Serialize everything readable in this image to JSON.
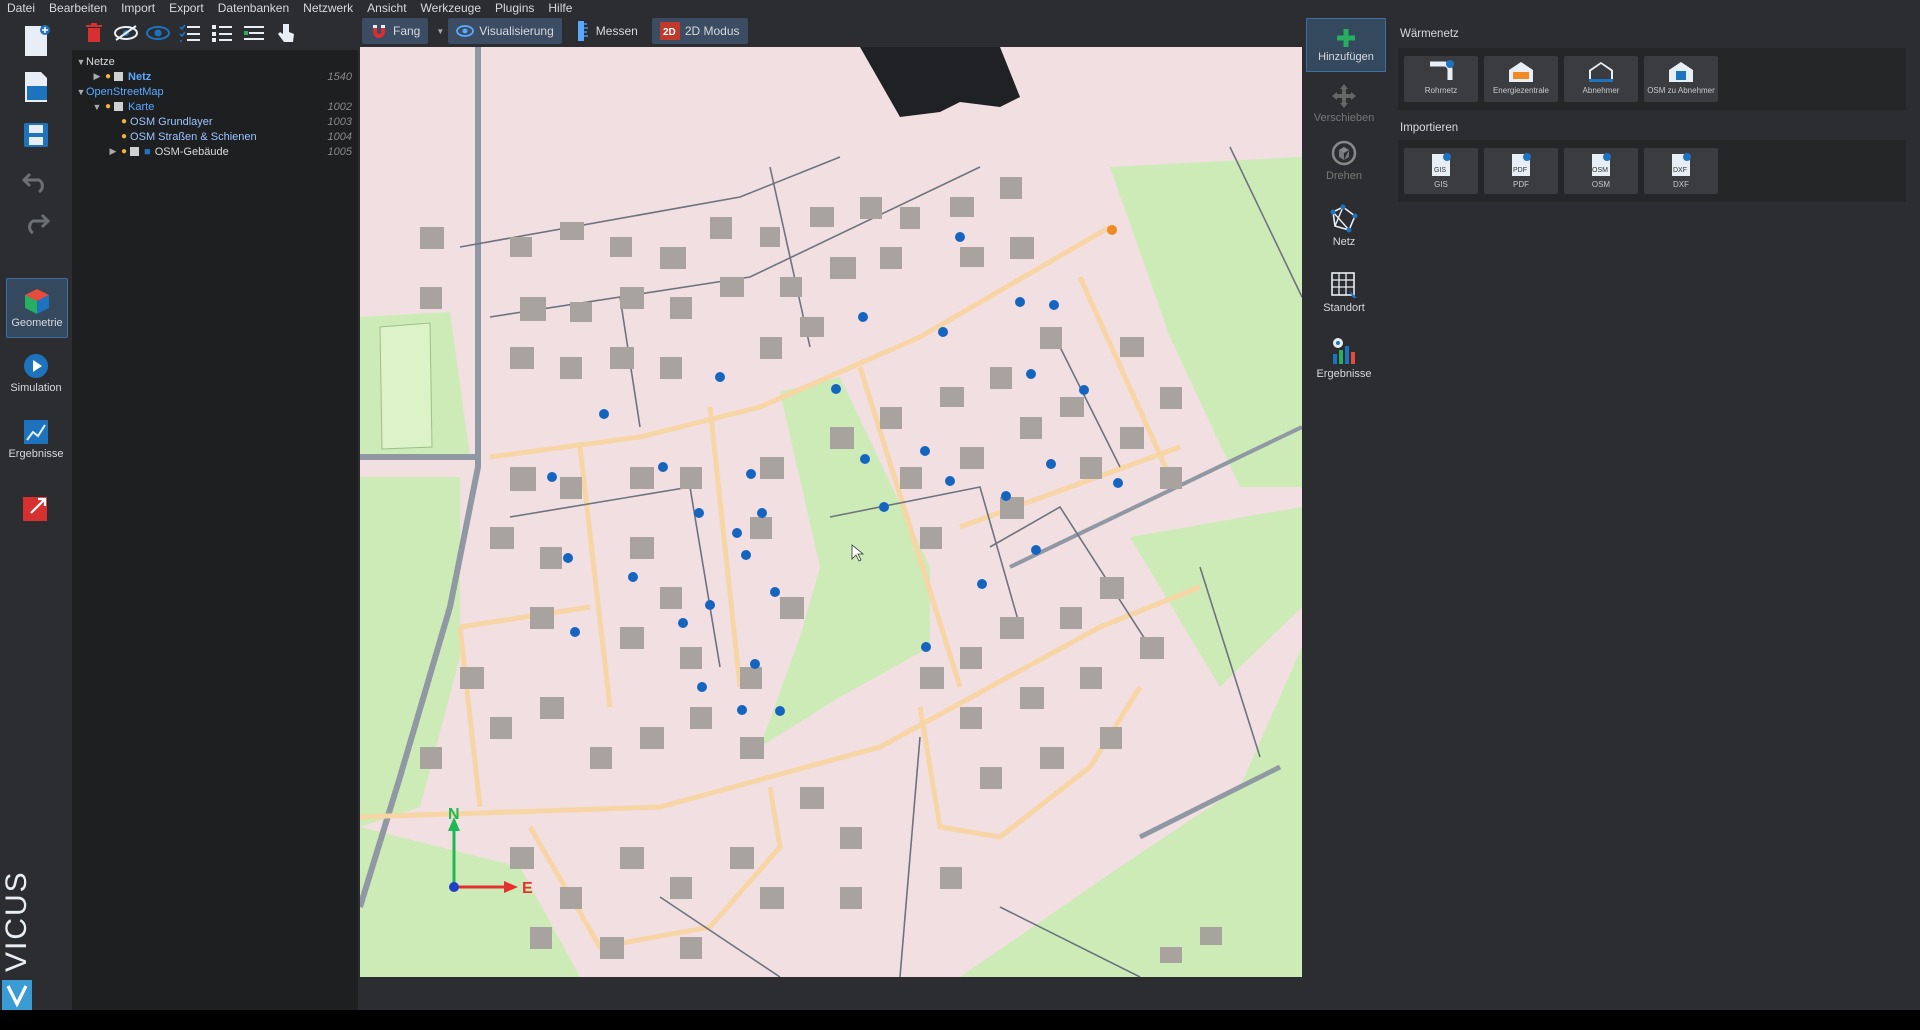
{
  "menu": [
    "Datei",
    "Bearbeiten",
    "Import",
    "Export",
    "Datenbanken",
    "Netzwerk",
    "Ansicht",
    "Werkzeuge",
    "Plugins",
    "Hilfe"
  ],
  "left_toolbar": {
    "geometry": "Geometrie",
    "simulation": "Simulation",
    "results": "Ergebnisse"
  },
  "tree": {
    "rows": [
      {
        "label": "Netze",
        "id": ""
      },
      {
        "label": "Netz",
        "id": "1540"
      },
      {
        "label": "OpenStreetMap",
        "id": ""
      },
      {
        "label": "Karte",
        "id": "1002"
      },
      {
        "label": "OSM Grundlayer",
        "id": "1003"
      },
      {
        "label": "OSM Straßen & Schienen",
        "id": "1004"
      },
      {
        "label": "OSM-Gebäude",
        "id": "1005"
      }
    ]
  },
  "view_toolbar": {
    "snap": "Fang",
    "visualization": "Visualisierung",
    "measure": "Messen",
    "mode": "2D Modus"
  },
  "viewport": {
    "axis_n": "N",
    "axis_e": "E"
  },
  "right_tools": {
    "add": "Hinzufügen",
    "move": "Verschieben",
    "rotate": "Drehen",
    "network": "Netz",
    "site": "Standort",
    "results": "Ergebnisse"
  },
  "waermenetz": {
    "title": "Wärmenetz",
    "items": [
      "Rohrnetz",
      "Energiezentrale",
      "Abnehmer",
      "OSM zu Abnehmer"
    ],
    "import_title": "Importieren",
    "import_items": [
      "GIS",
      "PDF",
      "OSM",
      "DXF"
    ]
  },
  "brand": "VICUS",
  "colors": {
    "accent": "#1e73be",
    "consumer_dot": "#1565c0",
    "land": "#f1dfe1",
    "green": "#cdebb6",
    "building": "#a9a39f",
    "road_major": "#f7d5a5"
  }
}
